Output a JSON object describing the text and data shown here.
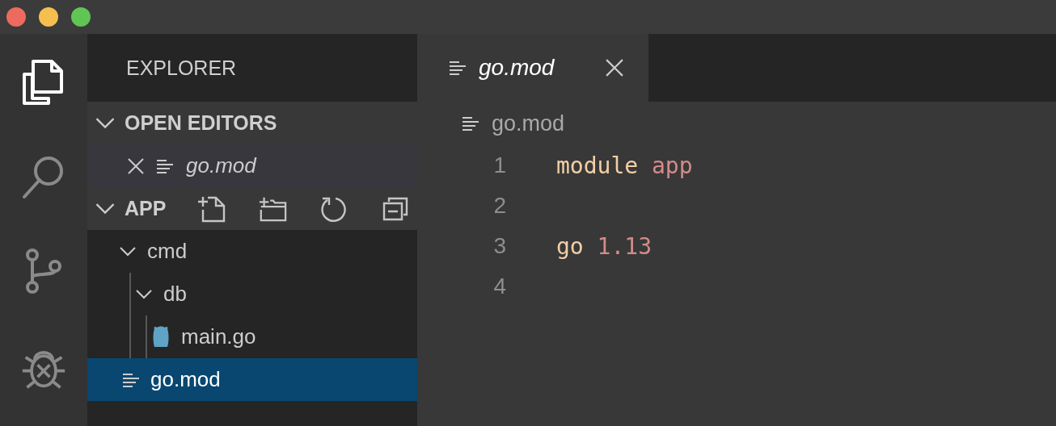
{
  "window": {
    "controls": [
      {
        "color": "#ed6a5e"
      },
      {
        "color": "#f4bf4f"
      },
      {
        "color": "#61c554"
      }
    ]
  },
  "activity_bar": [
    {
      "kind": "files",
      "selected": true
    },
    {
      "kind": "search",
      "selected": false
    },
    {
      "kind": "source-control",
      "selected": false
    },
    {
      "kind": "debug",
      "selected": false
    }
  ],
  "sidebar": {
    "title": "EXPLORER",
    "open_editors": {
      "title": "OPEN EDITORS",
      "expanded": true,
      "items": [
        {
          "name": "go.mod",
          "preview": true
        }
      ]
    },
    "folder": {
      "title": "APP",
      "expanded": true,
      "actions": [
        {
          "kind": "new-file"
        },
        {
          "kind": "new-folder"
        },
        {
          "kind": "refresh"
        },
        {
          "kind": "collapse"
        }
      ],
      "tree": [
        {
          "name": "cmd",
          "kind": "folder",
          "expanded": true,
          "selected": false,
          "children": [
            {
              "name": "db",
              "kind": "folder",
              "expanded": true,
              "selected": false,
              "children": [
                {
                  "name": "main.go",
                  "kind": "go",
                  "selected": false
                }
              ]
            }
          ]
        },
        {
          "name": "go.mod",
          "kind": "mod",
          "selected": true
        }
      ]
    }
  },
  "editor": {
    "tabs": [
      {
        "label": "go.mod",
        "preview": true,
        "selected": true
      }
    ],
    "breadcrumb": "go.mod",
    "lines": [
      {
        "number": "1",
        "tokens": [
          {
            "text": "module",
            "kind": "keyword"
          },
          {
            "text": "app",
            "kind": "value"
          }
        ]
      },
      {
        "number": "2"
      },
      {
        "number": "3",
        "tokens": [
          {
            "text": "go",
            "kind": "keyword"
          },
          {
            "text": "1.13",
            "kind": "value"
          }
        ]
      },
      {
        "number": "4"
      }
    ]
  }
}
